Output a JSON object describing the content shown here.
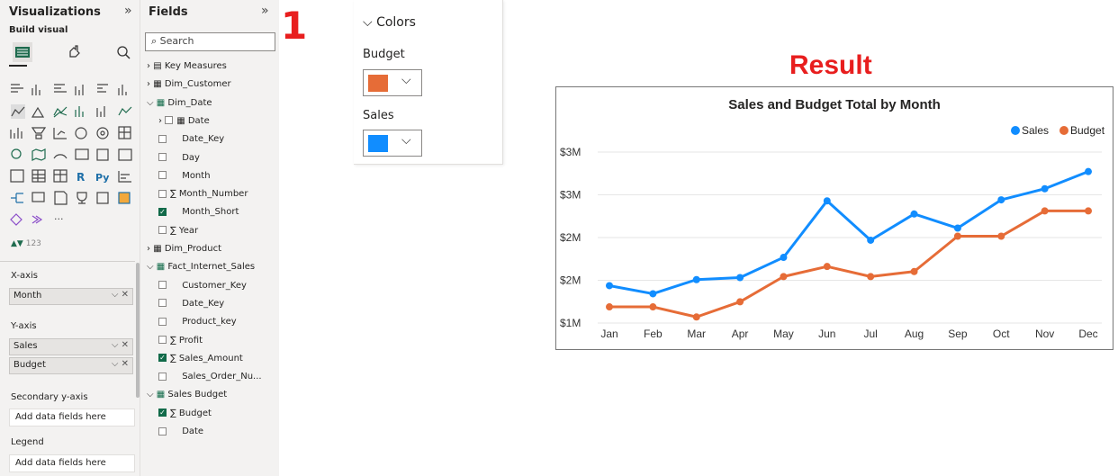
{
  "visualizations": {
    "title": "Visualizations",
    "collapse_glyph": "»",
    "build_visual_label": "Build visual",
    "x_axis": {
      "label": "X-axis",
      "items": [
        "Month"
      ]
    },
    "y_axis": {
      "label": "Y-axis",
      "items": [
        "Sales",
        "Budget"
      ]
    },
    "secondary_y": {
      "label": "Secondary y-axis",
      "placeholder": "Add data fields here"
    },
    "legend": {
      "label": "Legend",
      "placeholder": "Add data fields here"
    }
  },
  "fields": {
    "title": "Fields",
    "collapse_glyph": "»",
    "search_placeholder": "Search",
    "tree": [
      {
        "label": "Key Measures",
        "level": 0,
        "kind": "measure-table",
        "expand": ">"
      },
      {
        "label": "Dim_Customer",
        "level": 0,
        "kind": "table",
        "expand": ">"
      },
      {
        "label": "Dim_Date",
        "level": 0,
        "kind": "table-active",
        "expand": "v"
      },
      {
        "label": "Date",
        "level": 1,
        "kind": "date",
        "expand": ">",
        "check": "off"
      },
      {
        "label": "Date_Key",
        "level": 1,
        "kind": "field",
        "check": "off"
      },
      {
        "label": "Day",
        "level": 1,
        "kind": "field",
        "check": "off"
      },
      {
        "label": "Month",
        "level": 1,
        "kind": "field",
        "check": "off"
      },
      {
        "label": "Month_Number",
        "level": 1,
        "kind": "sum",
        "check": "off"
      },
      {
        "label": "Month_Short",
        "level": 1,
        "kind": "field",
        "check": "on"
      },
      {
        "label": "Year",
        "level": 1,
        "kind": "sum",
        "check": "off"
      },
      {
        "label": "Dim_Product",
        "level": 0,
        "kind": "table",
        "expand": ">"
      },
      {
        "label": "Fact_Internet_Sales",
        "level": 0,
        "kind": "table-active",
        "expand": "v"
      },
      {
        "label": "Customer_Key",
        "level": 1,
        "kind": "field",
        "check": "off"
      },
      {
        "label": "Date_Key",
        "level": 1,
        "kind": "field",
        "check": "off"
      },
      {
        "label": "Product_key",
        "level": 1,
        "kind": "field",
        "check": "off"
      },
      {
        "label": "Profit",
        "level": 1,
        "kind": "sum",
        "check": "off"
      },
      {
        "label": "Sales_Amount",
        "level": 1,
        "kind": "sum",
        "check": "on"
      },
      {
        "label": "Sales_Order_Nu...",
        "level": 1,
        "kind": "field",
        "check": "off"
      },
      {
        "label": "Sales Budget",
        "level": 0,
        "kind": "table-active",
        "expand": "v"
      },
      {
        "label": "Budget",
        "level": 1,
        "kind": "sum",
        "check": "on"
      },
      {
        "label": "Date",
        "level": 1,
        "kind": "field",
        "check": "off"
      }
    ]
  },
  "step_labels": [
    "1",
    "2"
  ],
  "colors_panel": {
    "header": "Colors",
    "entries": [
      {
        "label": "Budget",
        "color": "#E66C37"
      },
      {
        "label": "Sales",
        "color": "#118DFF"
      }
    ]
  },
  "result_label": "Result",
  "chart_data": {
    "type": "line",
    "title": "Sales and Budget Total by Month",
    "categories": [
      "Jan",
      "Feb",
      "Mar",
      "Apr",
      "May",
      "Jun",
      "Jul",
      "Aug",
      "Sep",
      "Oct",
      "Nov",
      "Dec"
    ],
    "y_ticks": [
      "$1M",
      "$2M",
      "$2M",
      "$3M",
      "$3M"
    ],
    "legend_position": "top-right",
    "grid": true,
    "series": [
      {
        "name": "Sales",
        "color": "#118DFF",
        "values": [
          1.87,
          1.79,
          1.93,
          1.95,
          2.15,
          2.71,
          2.32,
          2.58,
          2.44,
          2.72,
          2.83,
          3.0
        ]
      },
      {
        "name": "Budget",
        "color": "#E66C37",
        "values": [
          1.66,
          1.66,
          1.56,
          1.71,
          1.96,
          2.06,
          1.96,
          2.01,
          2.36,
          2.36,
          2.61,
          2.61
        ]
      }
    ],
    "ylim": [
      1.5,
      3.3
    ]
  }
}
